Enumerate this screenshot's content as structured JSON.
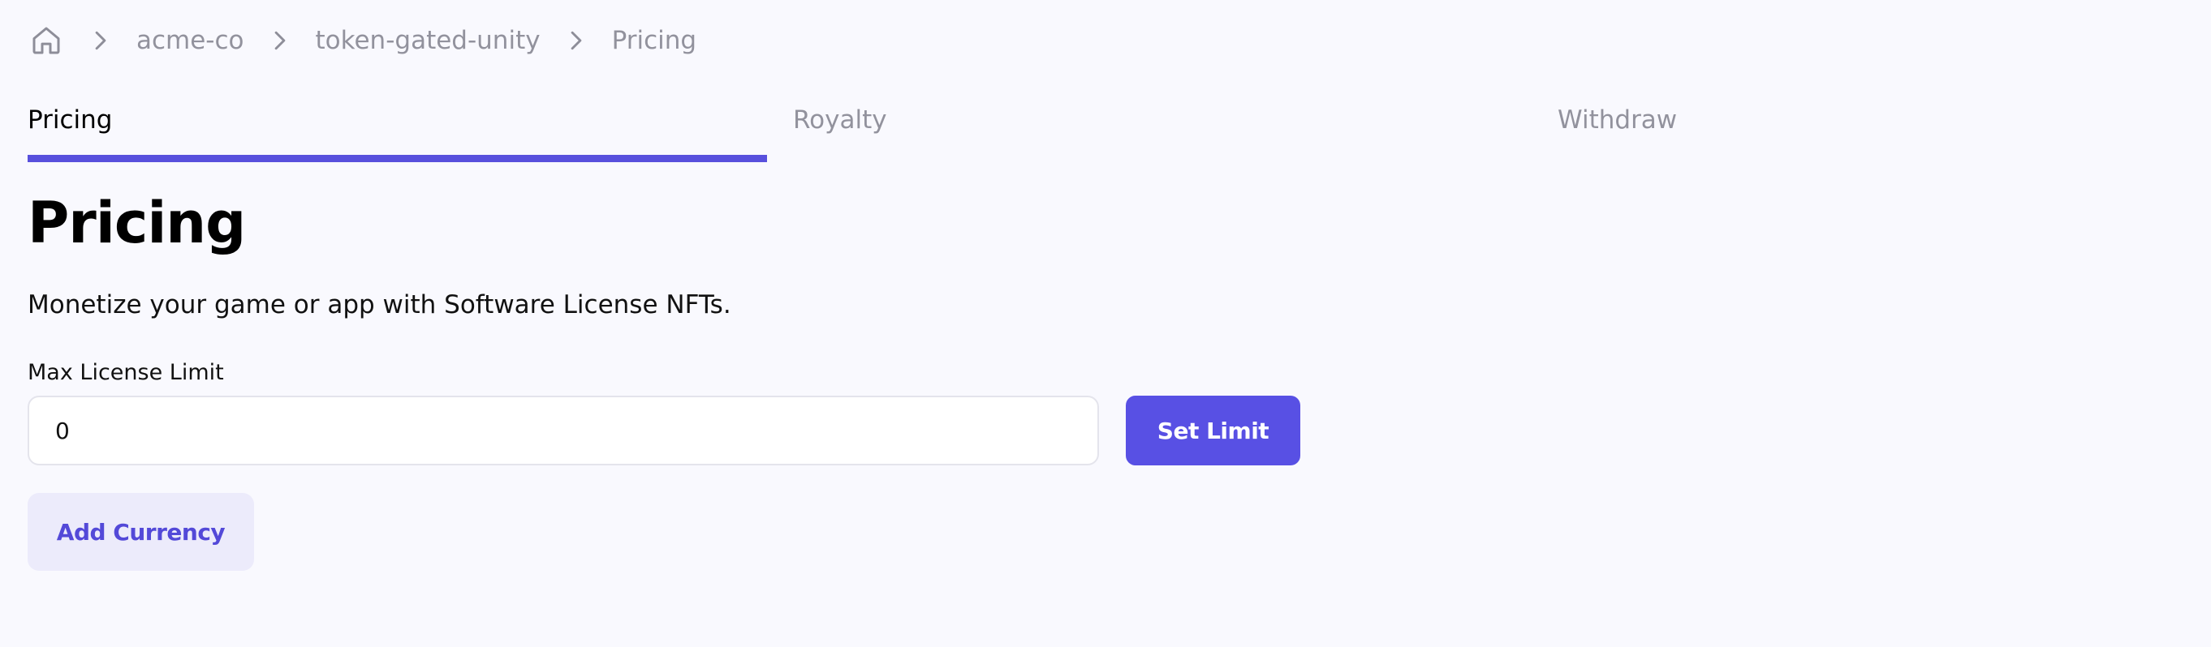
{
  "breadcrumb": {
    "home_icon": "home-icon",
    "separator_icon": "chevron-right-icon",
    "items": [
      {
        "label": "acme-co"
      },
      {
        "label": "token-gated-unity"
      },
      {
        "label": "Pricing"
      }
    ]
  },
  "tabs": [
    {
      "label": "Pricing",
      "active": true
    },
    {
      "label": "Royalty",
      "active": false
    },
    {
      "label": "Withdraw",
      "active": false
    }
  ],
  "main": {
    "title": "Pricing",
    "description": "Monetize your game or app with Software License NFTs.",
    "max_license_limit": {
      "label": "Max License Limit",
      "value": "0"
    },
    "set_limit_label": "Set Limit",
    "add_currency_label": "Add Currency"
  },
  "colors": {
    "accent": "#5850dd",
    "background": "#f9f9fe",
    "muted_text": "#92929d",
    "secondary_button_bg": "#ecebfb"
  }
}
